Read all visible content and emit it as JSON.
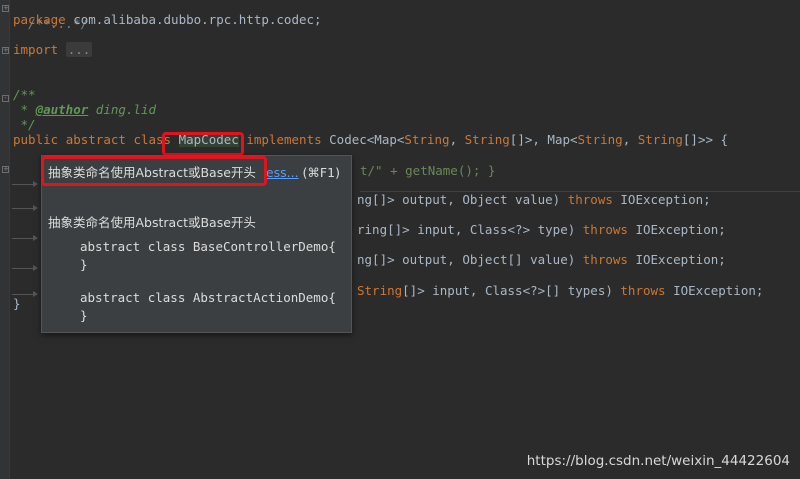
{
  "editor": {
    "l1_comment": "/**...*/",
    "l2_pkg_kw": "package",
    "l2_pkg_name": "com.alibaba.dubbo.rpc.http.codec;",
    "l3_import_kw": "import",
    "l3_import_folded": "...",
    "doc_open": "/**",
    "doc_star": " * ",
    "doc_tag": "@author",
    "doc_author": " ding.lid",
    "doc_close": " */",
    "decl_public": "public",
    "decl_abstract": "abstract",
    "decl_class": "class",
    "decl_name": "MapCodec",
    "decl_implements": "implements",
    "decl_codec": "Codec<Map<",
    "decl_string1": "String",
    "decl_comma1": ", ",
    "decl_string2": "String",
    "decl_arr1": "[]>, Map<",
    "decl_string3": "String",
    "decl_comma2": ", ",
    "decl_string4": "String",
    "decl_end": "[]>> {",
    "folded_body_tail1": "t/\" + getName(); }",
    "m1_pre": "ng[]> output, Object value) ",
    "m1_throws": "throws",
    "m1_exc": " IOException;",
    "m2_pre": "ring[]> input, Class<?> type) ",
    "m2_throws": "throws",
    "m2_exc": " IOException;",
    "m3_pre": "ng[]> output, Object[] value) ",
    "m3_throws": "throws",
    "m3_exc": " IOException;",
    "m4_string": "String",
    "m4_pre": "[]> input, Class<?>[] types) ",
    "m4_throws": "throws",
    "m4_exc": " IOException;",
    "closing_brace": "}"
  },
  "popup": {
    "rule_title": "抽象类命名使用Abstract或Base开头",
    "more_link": "ess...",
    "shortcut": "(⌘F1)",
    "description": "抽象类命名使用Abstract或Base开头",
    "example1_line1": "abstract class BaseControllerDemo{",
    "example1_line2": "}",
    "example2_line1": "abstract class AbstractActionDemo{",
    "example2_line2": "}"
  },
  "watermark": "https://blog.csdn.net/weixin_44422604"
}
